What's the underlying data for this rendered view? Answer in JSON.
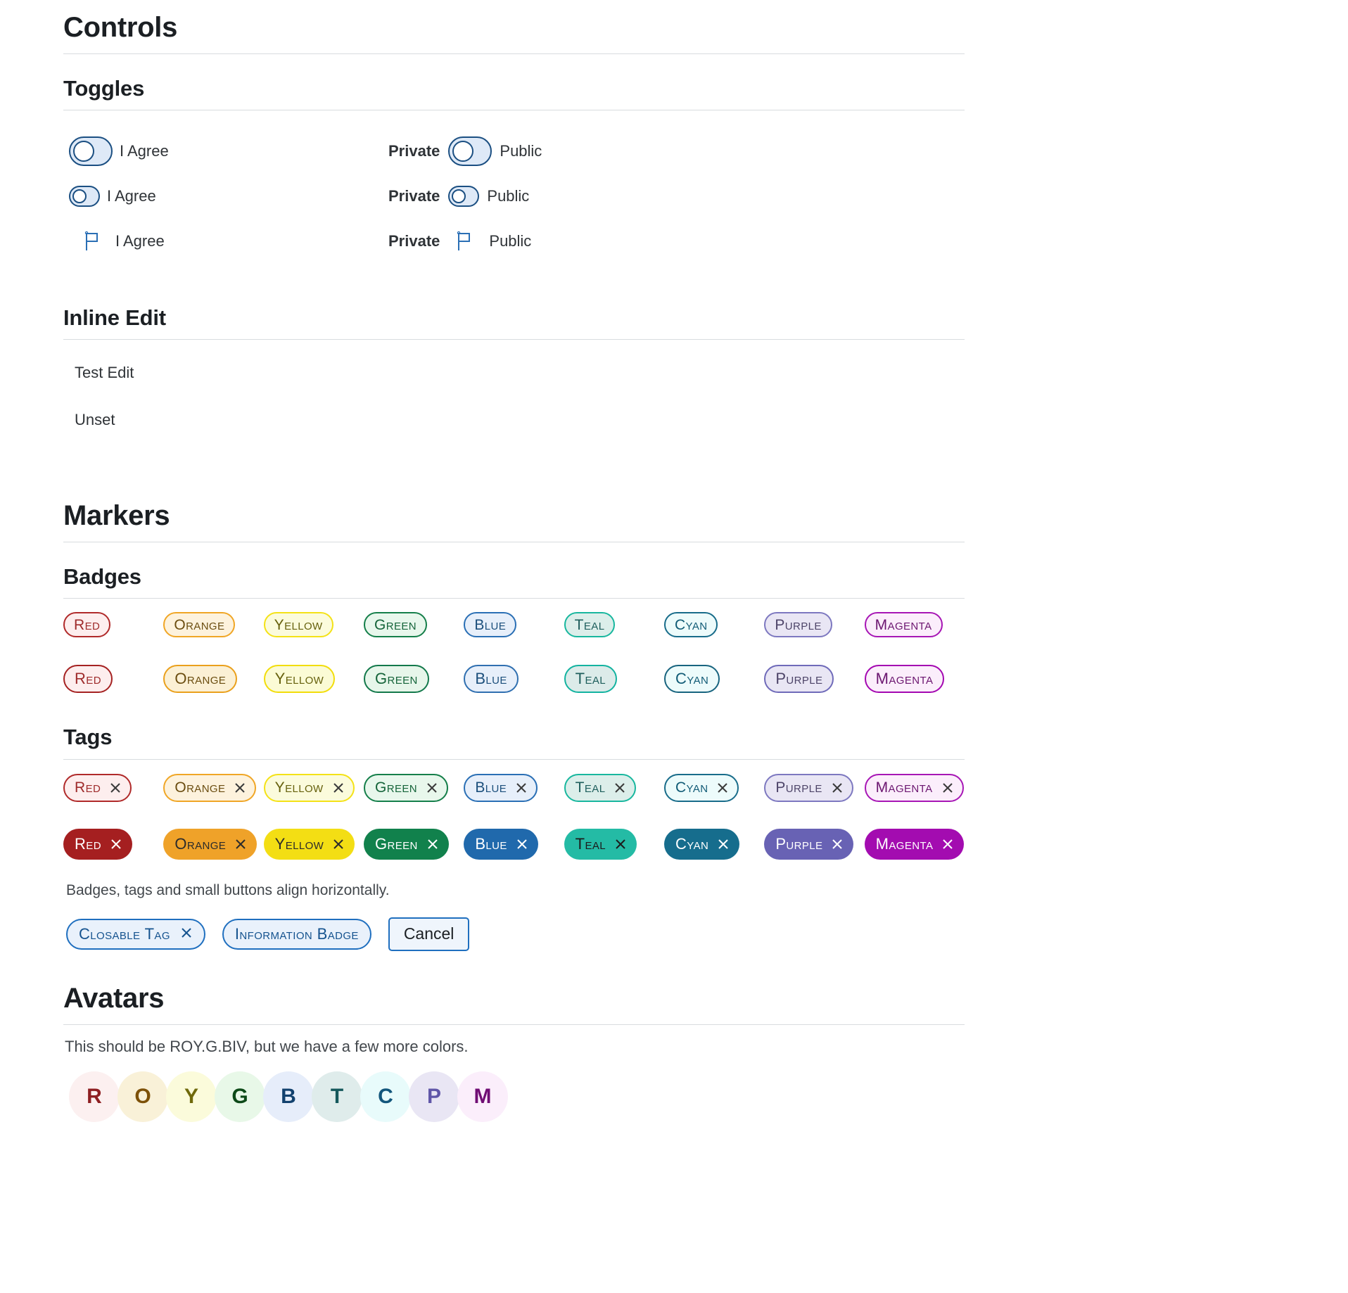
{
  "sections": {
    "controls": {
      "title": "Controls",
      "toggles": {
        "title": "Toggles",
        "rows": [
          {
            "left": {
              "control": "switch-large",
              "label": "I Agree"
            },
            "right": {
              "control": "switch-large",
              "pre_label": "Private",
              "post_label": "Public"
            }
          },
          {
            "left": {
              "control": "switch-small",
              "label": "I Agree"
            },
            "right": {
              "control": "switch-small",
              "pre_label": "Private",
              "post_label": "Public"
            }
          },
          {
            "left": {
              "control": "flag-icon",
              "label": "I Agree"
            },
            "right": {
              "control": "flag-icon",
              "pre_label": "Private",
              "post_label": "Public"
            }
          }
        ]
      },
      "inline_edit": {
        "title": "Inline Edit",
        "items": [
          {
            "value": "Test Edit"
          },
          {
            "value": "Unset"
          }
        ]
      }
    },
    "markers": {
      "title": "Markers",
      "badges": {
        "title": "Badges",
        "row1": [
          {
            "label": "Red",
            "text": "#9e2b2b",
            "border": "#b02a2a",
            "bg": "#fdeeee"
          },
          {
            "label": "Orange",
            "text": "#6b4d10",
            "border": "#f0a626",
            "bg": "#fdf2dd"
          },
          {
            "label": "Yellow",
            "text": "#66610d",
            "border": "#f4e217",
            "bg": "#fbfbdc"
          },
          {
            "label": "Green",
            "text": "#15643a",
            "border": "#157f4a",
            "bg": "#e8f7ec"
          },
          {
            "label": "Blue",
            "text": "#1c4f7c",
            "border": "#2a6fb5",
            "bg": "#e7effa"
          },
          {
            "label": "Teal",
            "text": "#1e5e5c",
            "border": "#18b79e",
            "bg": "#dceeea"
          },
          {
            "label": "Cyan",
            "text": "#115b76",
            "border": "#186c8a",
            "bg": "#edfbfb"
          },
          {
            "label": "Purple",
            "text": "#4d4468",
            "border": "#7d78c0",
            "bg": "#e9e6f4"
          },
          {
            "label": "Magenta",
            "text": "#6c1670",
            "border": "#a716b5",
            "bg": "#fbeefb"
          }
        ],
        "row2": [
          {
            "label": "Red",
            "text": "#9e2b2b",
            "border": "#a52222",
            "bg": "#fdeeee"
          },
          {
            "label": "Orange",
            "text": "#6b4d10",
            "border": "#eaa01c",
            "bg": "#fbf0d5"
          },
          {
            "label": "Yellow",
            "text": "#66610d",
            "border": "#f2dd0b",
            "bg": "#fbfbd5"
          },
          {
            "label": "Green",
            "text": "#15643a",
            "border": "#13794b",
            "bg": "#e7f6ea"
          },
          {
            "label": "Blue",
            "text": "#1c4f7c",
            "border": "#2f6fb0",
            "bg": "#e7effa"
          },
          {
            "label": "Teal",
            "text": "#1e5e5c",
            "border": "#13b3a0",
            "bg": "#dcebe9"
          },
          {
            "label": "Cyan",
            "text": "#115b76",
            "border": "#18647f",
            "bg": "#edfbfb"
          },
          {
            "label": "Purple",
            "text": "#4d4468",
            "border": "#6f6ab9",
            "bg": "#e9e6f4"
          },
          {
            "label": "Magenta",
            "text": "#6c1670",
            "border": "#a408b1",
            "bg": "#fbeefb"
          }
        ]
      },
      "tags": {
        "title": "Tags",
        "close_icon": "close-icon",
        "row1": [
          {
            "label": "Red",
            "text": "#9e2b2b",
            "border": "#b02a2a",
            "bg": "#fdeeee",
            "x": "#3a3a3a"
          },
          {
            "label": "Orange",
            "text": "#6b4d10",
            "border": "#f0a626",
            "bg": "#fdf2dd",
            "x": "#3a3a3a"
          },
          {
            "label": "Yellow",
            "text": "#66610d",
            "border": "#f4e217",
            "bg": "#fbfbdc",
            "x": "#3a3a3a"
          },
          {
            "label": "Green",
            "text": "#15643a",
            "border": "#157f4a",
            "bg": "#e8f7ec",
            "x": "#3a3a3a"
          },
          {
            "label": "Blue",
            "text": "#1c4f7c",
            "border": "#2a6fb5",
            "bg": "#e7effa",
            "x": "#3a3a3a"
          },
          {
            "label": "Teal",
            "text": "#1e5e5c",
            "border": "#18b79e",
            "bg": "#dceeea",
            "x": "#3a3a3a"
          },
          {
            "label": "Cyan",
            "text": "#115b76",
            "border": "#186c8a",
            "bg": "#edfbfb",
            "x": "#3a3a3a"
          },
          {
            "label": "Purple",
            "text": "#4d4468",
            "border": "#7d78c0",
            "bg": "#e9e6f4",
            "x": "#3a3a3a"
          },
          {
            "label": "Magenta",
            "text": "#6c1670",
            "border": "#a716b5",
            "bg": "#fbeefb",
            "x": "#3a3a3a"
          }
        ],
        "row2": [
          {
            "label": "Red",
            "text": "#ffffff",
            "bg": "#a51f20",
            "x": "#ffffff"
          },
          {
            "label": "Orange",
            "text": "#2b2b2b",
            "bg": "#efa229",
            "x": "#2b2b2b"
          },
          {
            "label": "Yellow",
            "text": "#2b2b2b",
            "bg": "#f3de14",
            "x": "#2b2b2b"
          },
          {
            "label": "Green",
            "text": "#ffffff",
            "bg": "#11814c",
            "x": "#ffffff"
          },
          {
            "label": "Blue",
            "text": "#ffffff",
            "bg": "#2069ac",
            "x": "#ffffff"
          },
          {
            "label": "Teal",
            "text": "#1c1c1c",
            "bg": "#24bba5",
            "x": "#1c1c1c"
          },
          {
            "label": "Cyan",
            "text": "#ffffff",
            "bg": "#166d8d",
            "x": "#ffffff"
          },
          {
            "label": "Purple",
            "text": "#ffffff",
            "bg": "#6862b4",
            "x": "#ffffff"
          },
          {
            "label": "Magenta",
            "text": "#ffffff",
            "bg": "#a30cb0",
            "x": "#ffffff"
          }
        ]
      },
      "align_note": "Badges, tags and small buttons align horizontally.",
      "actions": {
        "closable_tag": "Closable Tag",
        "information_badge": "Information Badge",
        "cancel": "Cancel"
      }
    },
    "avatars": {
      "title": "Avatars",
      "note": "This should be ROY.G.BIV, but we have a few more colors.",
      "items": [
        {
          "initial": "R",
          "bg": "#fcf0f0",
          "color": "#8e1f22"
        },
        {
          "initial": "O",
          "bg": "#f9f1d8",
          "color": "#7d5108"
        },
        {
          "initial": "Y",
          "bg": "#fbfbdb",
          "color": "#6f690b"
        },
        {
          "initial": "G",
          "bg": "#e8f8e8",
          "color": "#0d4a18"
        },
        {
          "initial": "B",
          "bg": "#e6edfa",
          "color": "#12416e"
        },
        {
          "initial": "T",
          "bg": "#dfeceb",
          "color": "#14585b"
        },
        {
          "initial": "C",
          "bg": "#e8fbfb",
          "color": "#12567c"
        },
        {
          "initial": "P",
          "bg": "#e9e6f4",
          "color": "#6056a8"
        },
        {
          "initial": "M",
          "bg": "#fbeefb",
          "color": "#700d74"
        }
      ]
    }
  }
}
